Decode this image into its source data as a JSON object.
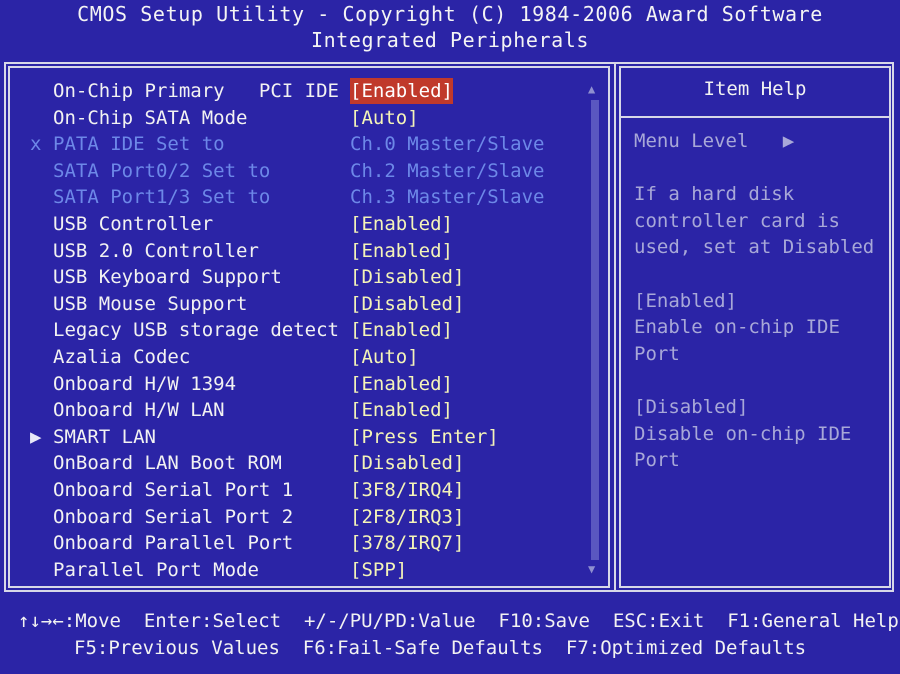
{
  "header": {
    "title": "CMOS Setup Utility - Copyright (C) 1984-2006 Award Software",
    "subtitle": "Integrated Peripherals"
  },
  "settings": [
    {
      "marker": "",
      "label": "On-Chip Primary   PCI IDE",
      "value": "[Enabled]",
      "state": "selected"
    },
    {
      "marker": "",
      "label": "On-Chip SATA Mode",
      "value": "[Auto]",
      "state": "normal"
    },
    {
      "marker": "x",
      "label": "PATA IDE Set to",
      "value": "Ch.0 Master/Slave",
      "state": "disabled"
    },
    {
      "marker": "",
      "label": "SATA Port0/2 Set to",
      "value": "Ch.2 Master/Slave",
      "state": "disabled"
    },
    {
      "marker": "",
      "label": "SATA Port1/3 Set to",
      "value": "Ch.3 Master/Slave",
      "state": "disabled"
    },
    {
      "marker": "",
      "label": "USB Controller",
      "value": "[Enabled]",
      "state": "normal"
    },
    {
      "marker": "",
      "label": "USB 2.0 Controller",
      "value": "[Enabled]",
      "state": "normal"
    },
    {
      "marker": "",
      "label": "USB Keyboard Support",
      "value": "[Disabled]",
      "state": "normal"
    },
    {
      "marker": "",
      "label": "USB Mouse Support",
      "value": "[Disabled]",
      "state": "normal"
    },
    {
      "marker": "",
      "label": "Legacy USB storage detect",
      "value": "[Enabled]",
      "state": "normal"
    },
    {
      "marker": "",
      "label": "Azalia Codec",
      "value": "[Auto]",
      "state": "normal"
    },
    {
      "marker": "",
      "label": "Onboard H/W 1394",
      "value": "[Enabled]",
      "state": "normal"
    },
    {
      "marker": "",
      "label": "Onboard H/W LAN",
      "value": "[Enabled]",
      "state": "normal"
    },
    {
      "marker": "▶",
      "label": "SMART LAN",
      "value": "[Press Enter]",
      "state": "normal"
    },
    {
      "marker": "",
      "label": "OnBoard LAN Boot ROM",
      "value": "[Disabled]",
      "state": "normal"
    },
    {
      "marker": "",
      "label": "Onboard Serial Port 1",
      "value": "[3F8/IRQ4]",
      "state": "normal"
    },
    {
      "marker": "",
      "label": "Onboard Serial Port 2",
      "value": "[2F8/IRQ3]",
      "state": "normal"
    },
    {
      "marker": "",
      "label": "Onboard Parallel Port",
      "value": "[378/IRQ7]",
      "state": "normal"
    },
    {
      "marker": "",
      "label": "Parallel Port Mode",
      "value": "[SPP]",
      "state": "normal"
    }
  ],
  "help": {
    "title": "Item Help",
    "lines": [
      "Menu Level   ▶",
      "",
      "If a hard disk",
      "controller card is",
      "used, set at Disabled",
      "",
      "[Enabled]",
      "Enable on-chip IDE",
      "Port",
      "",
      "[Disabled]",
      "Disable on-chip IDE",
      "Port"
    ]
  },
  "footer": {
    "line1": "↑↓→←:Move  Enter:Select  +/-/PU/PD:Value  F10:Save  ESC:Exit  F1:General Help",
    "line2": "F5:Previous Values  F6:Fail-Safe Defaults  F7:Optimized Defaults"
  },
  "scrollbar": {
    "up_glyph": "▲",
    "down_glyph": "▼"
  },
  "colors": {
    "background": "#2b24a6",
    "text": "#f2f2f2",
    "disabled_text": "#6d88e8",
    "value_text": "#f4f4b8",
    "selection_bg": "#c0392b",
    "help_text": "#a8a8d8"
  }
}
